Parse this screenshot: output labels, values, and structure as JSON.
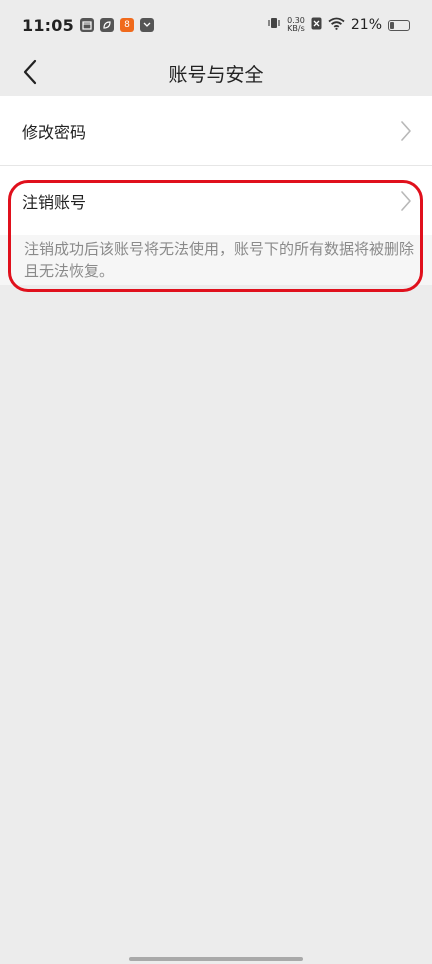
{
  "status_bar": {
    "time": "11:05",
    "net_speed_value": "0.30",
    "net_speed_unit": "KB/s",
    "battery_percent": "21%",
    "battery_level": 0.21,
    "notif_badge_text": "8"
  },
  "nav": {
    "title": "账号与安全",
    "back_icon": "chevron-left-icon"
  },
  "menu": {
    "items": [
      {
        "label": "修改密码",
        "icon": "chevron-right-icon"
      },
      {
        "label": "注销账号",
        "icon": "chevron-right-icon"
      }
    ],
    "description": "注销成功后该账号将无法使用，账号下的所有数据将被删除且无法恢复。"
  },
  "colors": {
    "highlight": "#e0101c",
    "background": "#ececec",
    "card": "#ffffff",
    "secondary_text": "#8a8a8a"
  }
}
